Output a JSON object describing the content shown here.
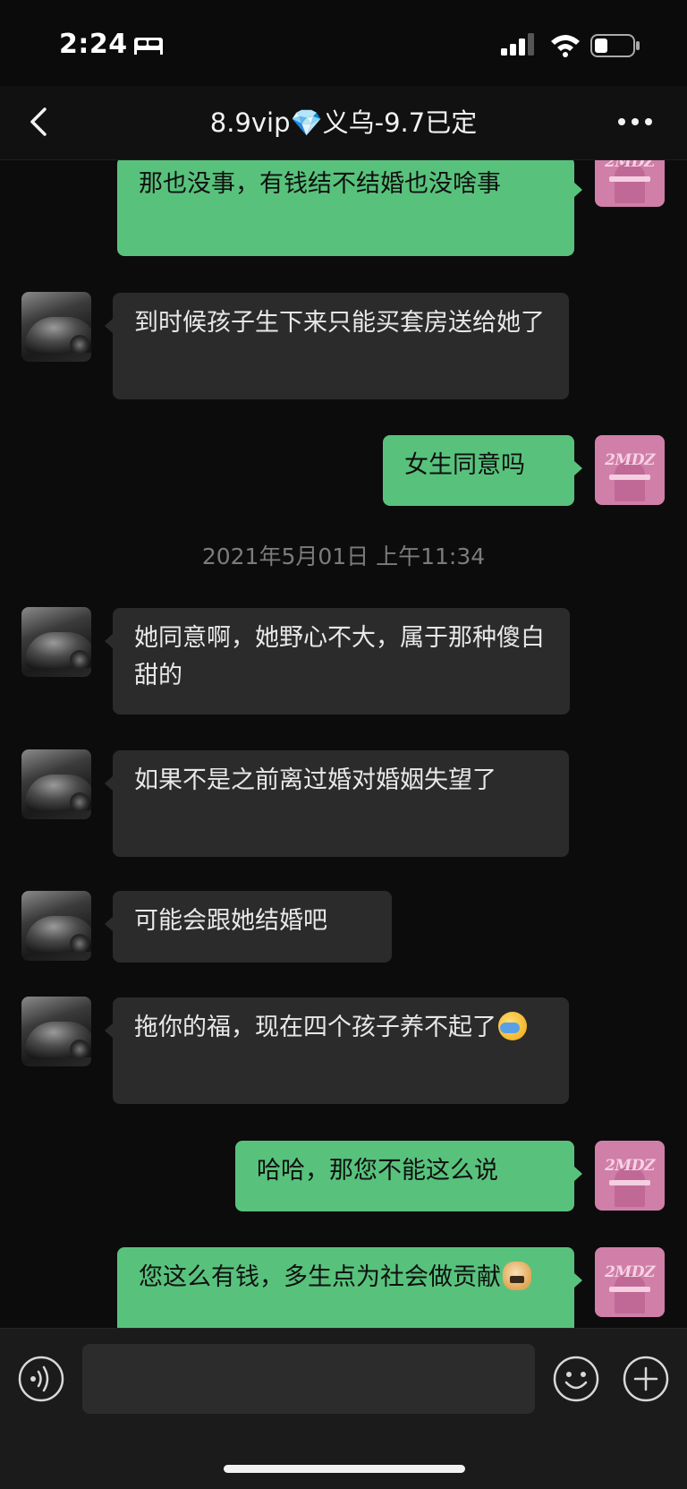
{
  "status_bar": {
    "time": "2:24"
  },
  "header": {
    "title": "8.9vip💎义乌-9.7已定"
  },
  "messages": [
    {
      "side": "out",
      "text": "那也没事，有钱结不结婚也没啥事"
    },
    {
      "side": "in",
      "text": "到时候孩子生下来只能买套房送给她了"
    },
    {
      "side": "out",
      "text": "女生同意吗"
    },
    {
      "side": "in",
      "text": "她同意啊，她野心不大，属于那种傻白甜的"
    },
    {
      "side": "in",
      "text": "如果不是之前离过婚对婚姻失望了"
    },
    {
      "side": "in",
      "text": "可能会跟她结婚吧"
    },
    {
      "side": "in",
      "text": "拖你的福，现在四个孩子养不起了",
      "emoji": "facepalm-emoji"
    },
    {
      "side": "out",
      "text": "哈哈，那您不能这么说"
    },
    {
      "side": "out",
      "text": "您这么有钱，多生点为社会做贡献",
      "emoji": "doge-emoji"
    }
  ],
  "timestamp": "2021年5月01日 上午11:34",
  "avatars": {
    "self_logo_text": "2MDZ"
  },
  "composer": {
    "input_value": ""
  },
  "colors": {
    "outgoing_bubble": "#58c27c",
    "incoming_bubble": "#2b2b2b",
    "background": "#0c0c0c"
  }
}
